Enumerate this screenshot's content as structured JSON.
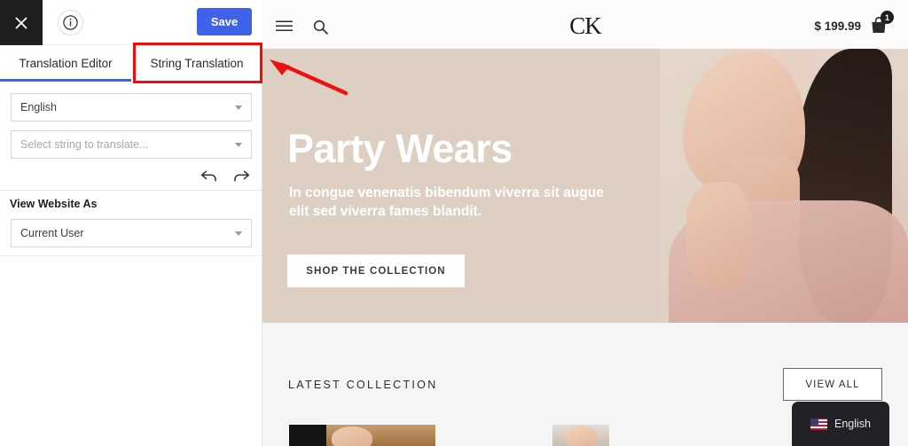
{
  "sidebar": {
    "topbar": {
      "close_icon": "close-icon",
      "info_icon": "info-icon",
      "save_label": "Save"
    },
    "tabs": [
      {
        "label": "Translation Editor",
        "active": true
      },
      {
        "label": "String Translation",
        "active": false,
        "highlighted": true
      }
    ],
    "language_select": {
      "value": "English",
      "caret_icon": "chevron-down-icon"
    },
    "string_select": {
      "placeholder": "Select string to translate...",
      "caret_icon": "chevron-down-icon"
    },
    "history": {
      "undo_icon": "undo-arrow-icon",
      "redo_icon": "redo-arrow-icon"
    },
    "view_website_as": {
      "label": "View Website As",
      "value": "Current User",
      "caret_icon": "chevron-down-icon"
    }
  },
  "site": {
    "header": {
      "menu_icon": "hamburger-menu-icon",
      "search_icon": "search-icon",
      "logo_text": "CK",
      "cart_price": "$ 199.99",
      "cart_icon": "shopping-bag-icon",
      "cart_count": "1"
    },
    "hero": {
      "title": "Party Wears",
      "subtitle": "In congue venenatis bibendum viverra sit augue elit sed viverra fames blandit.",
      "cta_label": "SHOP THE COLLECTION",
      "background_color": "#ddd0c2"
    },
    "collection": {
      "title": "LATEST COLLECTION",
      "view_all_label": "VIEW ALL",
      "background_color": "#f5f5f5"
    },
    "language_switcher": {
      "flag_icon": "us-flag-icon",
      "label": "English"
    }
  },
  "annotation": {
    "arrow_color": "#ee1111",
    "highlight_color": "#f00b0b"
  }
}
